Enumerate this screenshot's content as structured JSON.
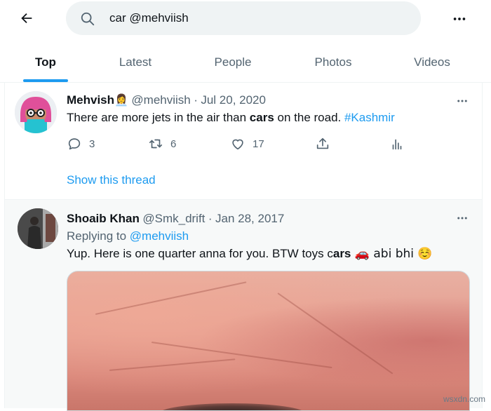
{
  "search": {
    "query": "car @mehviish"
  },
  "tabs": [
    {
      "label": "Top",
      "active": true
    },
    {
      "label": "Latest",
      "active": false
    },
    {
      "label": "People",
      "active": false
    },
    {
      "label": "Photos",
      "active": false
    },
    {
      "label": "Videos",
      "active": false
    }
  ],
  "tweets": [
    {
      "display_name": "Mehvish",
      "name_emoji": "👩‍💼",
      "handle": "@mehviish",
      "date": "Jul 20, 2020",
      "text_before": "There are more jets in the air than ",
      "keyword": "cars",
      "text_after": " on the road. ",
      "hashtag": "#Kashmir",
      "replies": "3",
      "retweets": "6",
      "likes": "17",
      "show_thread": "Show this thread"
    },
    {
      "display_name": "Shoaib Khan",
      "handle": "@Smk_drift",
      "date": "Jan 28, 2017",
      "replying_prefix": "Replying to ",
      "replying_handle": "@mehviish",
      "text_before": "Yup. Here is one quarter anna for you. BTW toys c",
      "keyword": "ars",
      "text_after": " 🚗 abi bhi ☺️"
    }
  ],
  "watermark": "wsxdn.com",
  "colors": {
    "accent": "#1d9bf0",
    "text": "#0f1419",
    "muted": "#536471",
    "search_bg": "#eff3f4"
  }
}
